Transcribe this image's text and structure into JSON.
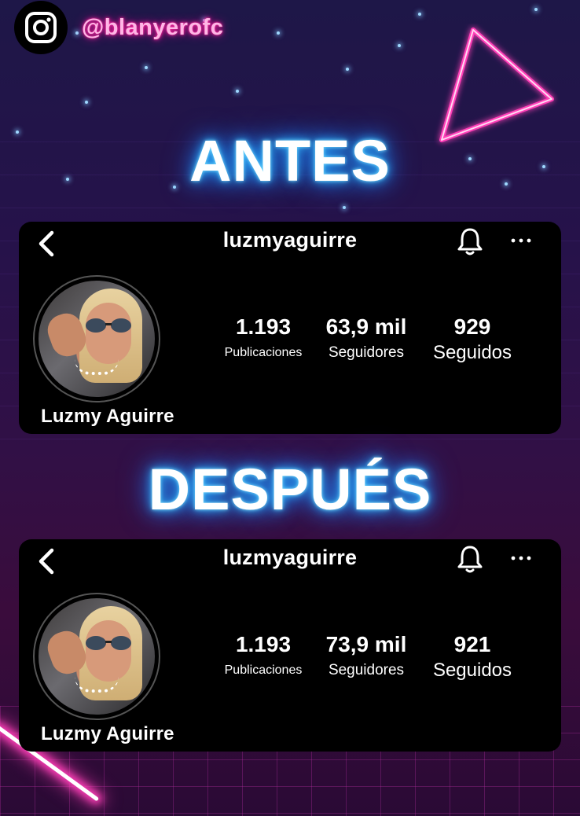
{
  "brand": {
    "handle": "@blanyerofc",
    "icon": "instagram-icon"
  },
  "headlines": {
    "before": "ANTES",
    "after": "DESPUÉS"
  },
  "profiles": [
    {
      "username": "luzmyaguirre",
      "display_name": "Luzmy Aguirre",
      "stats": [
        {
          "value": "1.193",
          "label": "Publicaciones"
        },
        {
          "value": "63,9 mil",
          "label": "Seguidores"
        },
        {
          "value": "929",
          "label": "Seguidos"
        }
      ]
    },
    {
      "username": "luzmyaguirre",
      "display_name": "Luzmy Aguirre",
      "stats": [
        {
          "value": "1.193",
          "label": "Publicaciones"
        },
        {
          "value": "73,9 mil",
          "label": "Seguidores"
        },
        {
          "value": "921",
          "label": "Seguidos"
        }
      ]
    }
  ],
  "icons": {
    "back": "chevron-left-icon",
    "bell": "bell-icon",
    "more": "more-horizontal-icon"
  },
  "colors": {
    "neon_pink": "#ff2aa0",
    "neon_blue": "#2fb9ff",
    "card_bg": "#000000"
  }
}
